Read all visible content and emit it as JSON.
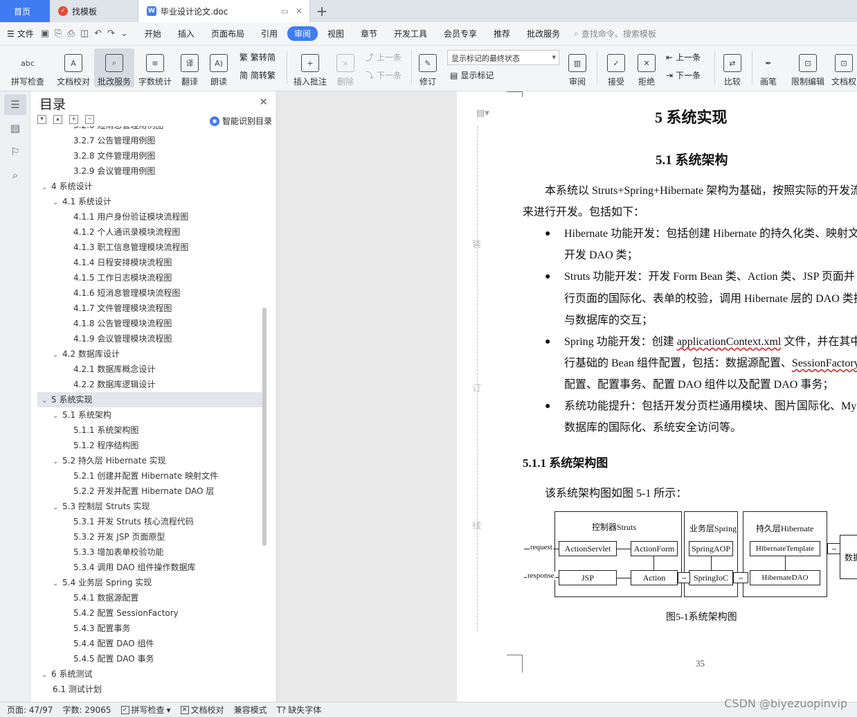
{
  "tabs": {
    "home": "首页",
    "template": "找模板",
    "document": "毕业设计论文.doc"
  },
  "menu": {
    "file": "文件",
    "items": [
      "开始",
      "插入",
      "页面布局",
      "引用",
      "审阅",
      "视图",
      "章节",
      "开发工具",
      "会员专享",
      "推荐",
      "批改服务"
    ],
    "active": "审阅",
    "search": "查找命令、搜索模板"
  },
  "ribbon": {
    "spellcheck": "拼写检查",
    "doccheck": "文档校对",
    "review_service": "批改服务",
    "wordcount": "字数统计",
    "translate": "翻译",
    "read_aloud": "朗读",
    "trad_to_simp": "繁转简",
    "simp_to_trad": "简转繁",
    "insert_comment": "插入批注",
    "delete": "删除",
    "prev": "上一条",
    "next": "下一条",
    "track": "修订",
    "markup_state": "显示标记的最终状态",
    "show_markup": "显示标记",
    "review_pane": "审阅",
    "accept": "接受",
    "reject": "拒绝",
    "prev2": "上一条",
    "next2": "下一条",
    "compare": "比较",
    "pen": "画笔",
    "restrict": "限制编辑",
    "doc_perm": "文档权"
  },
  "toc": {
    "title": "目录",
    "smart": "智能识别目录",
    "items": [
      {
        "level": 3,
        "text": "3.2.6 短消息管理用例图"
      },
      {
        "level": 3,
        "text": "3.2.7 公告管理用例图"
      },
      {
        "level": 3,
        "text": "3.2.8 文件管理用例图"
      },
      {
        "level": 3,
        "text": "3.2.9 会议管理用例图"
      },
      {
        "level": 1,
        "text": "4  系统设计",
        "arrow": true
      },
      {
        "level": 2,
        "text": "4.1  系统设计",
        "arrow": true
      },
      {
        "level": 3,
        "text": "4.1.1  用户身份验证模块流程图"
      },
      {
        "level": 3,
        "text": "4.1.2  个人通讯录模块流程图"
      },
      {
        "level": 3,
        "text": "4.1.3  职工信息管理模块流程图"
      },
      {
        "level": 3,
        "text": "4.1.4  日程安排模块流程图"
      },
      {
        "level": 3,
        "text": "4.1.5  工作日志模块流程图"
      },
      {
        "level": 3,
        "text": "4.1.6  短消息管理模块流程图"
      },
      {
        "level": 3,
        "text": "4.1.7  文件管理模块流程图"
      },
      {
        "level": 3,
        "text": "4.1.8  公告管理模块流程图"
      },
      {
        "level": 3,
        "text": "4.1.9  会议管理模块流程图"
      },
      {
        "level": 2,
        "text": "4.2  数据库设计",
        "arrow": true
      },
      {
        "level": 3,
        "text": "4.2.1  数据库概念设计"
      },
      {
        "level": 3,
        "text": "4.2.2  数据库逻辑设计"
      },
      {
        "level": 1,
        "text": "5  系统实现",
        "arrow": true,
        "selected": true
      },
      {
        "level": 2,
        "text": "5.1  系统架构",
        "arrow": true
      },
      {
        "level": 3,
        "text": "5.1.1  系统架构图"
      },
      {
        "level": 3,
        "text": "5.1.2  程序结构图"
      },
      {
        "level": 2,
        "text": "5.2  持久层 Hibernate 实现",
        "arrow": true
      },
      {
        "level": 3,
        "text": "5.2.1  创建并配置 Hibernate 映射文件"
      },
      {
        "level": 3,
        "text": "5.2.2  开发并配置 Hibernate DAO 层"
      },
      {
        "level": 2,
        "text": "5.3  控制层 Struts 实现",
        "arrow": true
      },
      {
        "level": 3,
        "text": "5.3.1  开发 Struts 核心流程代码"
      },
      {
        "level": 3,
        "text": "5.3.2  开发 JSP 页面原型"
      },
      {
        "level": 3,
        "text": "5.3.3  增加表单校验功能"
      },
      {
        "level": 3,
        "text": "5.3.4  调用 DAO 组件操作数据库"
      },
      {
        "level": 2,
        "text": "5.4  业务层 Spring 实现",
        "arrow": true
      },
      {
        "level": 3,
        "text": "5.4.1  数据源配置"
      },
      {
        "level": 3,
        "text": "5.4.2  配置 SessionFactory"
      },
      {
        "level": 3,
        "text": "5.4.3  配置事务"
      },
      {
        "level": 3,
        "text": "5.4.4  配置 DAO 组件"
      },
      {
        "level": 3,
        "text": "5.4.5  配置 DAO 事务"
      },
      {
        "level": 1,
        "text": "6  系统测试",
        "arrow": true
      },
      {
        "level": 2,
        "text": "6.1  测试计划"
      }
    ]
  },
  "page": {
    "binding_marks": [
      "装",
      "订",
      "线"
    ],
    "h1": "5  系统实现",
    "h2": "5.1  系统架构",
    "intro_line1": "本系统以 Struts+Spring+Hibernate 架构为基础，按照实际的开发流",
    "intro_line2": "来进行开发。包括如下：",
    "b1_l1": "Hibernate 功能开发：包括创建 Hibernate 的持久化类、映射文件",
    "b1_l2": "开发 DAO 类；",
    "b2_l1": "Struts 功能开发：开发 Form Bean 类、Action 类、JSP 页面并",
    "b2_l2": "行页面的国际化、表单的校验，调用 Hibernate 层的 DAO 类执",
    "b2_l3": "与数据库的交互；",
    "b3_l1_pre": "Spring 功能开发：创建 ",
    "b3_l1_wavy": "applicationContext.xml",
    "b3_l1_post": " 文件，并在其中",
    "b3_l2_pre": "行基础的 Bean 组件配置，包括：数据源配置、",
    "b3_l2_wavy": "SessionFactory",
    "b3_l3": "配置、配置事务、配置 DAO 组件以及配置 DAO 事务；",
    "b4_l1": "系统功能提升：包括开发分页栏通用模块、图片国际化、MyS",
    "b4_l2": "数据库的国际化、系统安全访问等。",
    "h3": "5.1.1  系统架构图",
    "fig_intro": "该系统架构图如图 5-1 所示：",
    "caption": "图5-1系统架构图",
    "page_number": "35",
    "diagram": {
      "group1": "控制器Struts",
      "group2": "业务层Spring",
      "group3": "持久层Hibernate",
      "request": "request",
      "response": "response",
      "servlet": "ActionServlet",
      "form": "ActionForm",
      "jsp": "JSP",
      "action": "Action",
      "aop": "SpringAOP",
      "ioc": "SpringIoC",
      "template": "HibernateTemplate",
      "dao": "HibernateDAO",
      "db": "数据"
    }
  },
  "status": {
    "page": "页面: 47/97",
    "words": "字数: 29065",
    "spell": "拼写检查",
    "doccheck": "文档校对",
    "compat": "兼容模式",
    "missing_font": "缺失字体"
  },
  "watermark": "CSDN @biyezuopinvip"
}
